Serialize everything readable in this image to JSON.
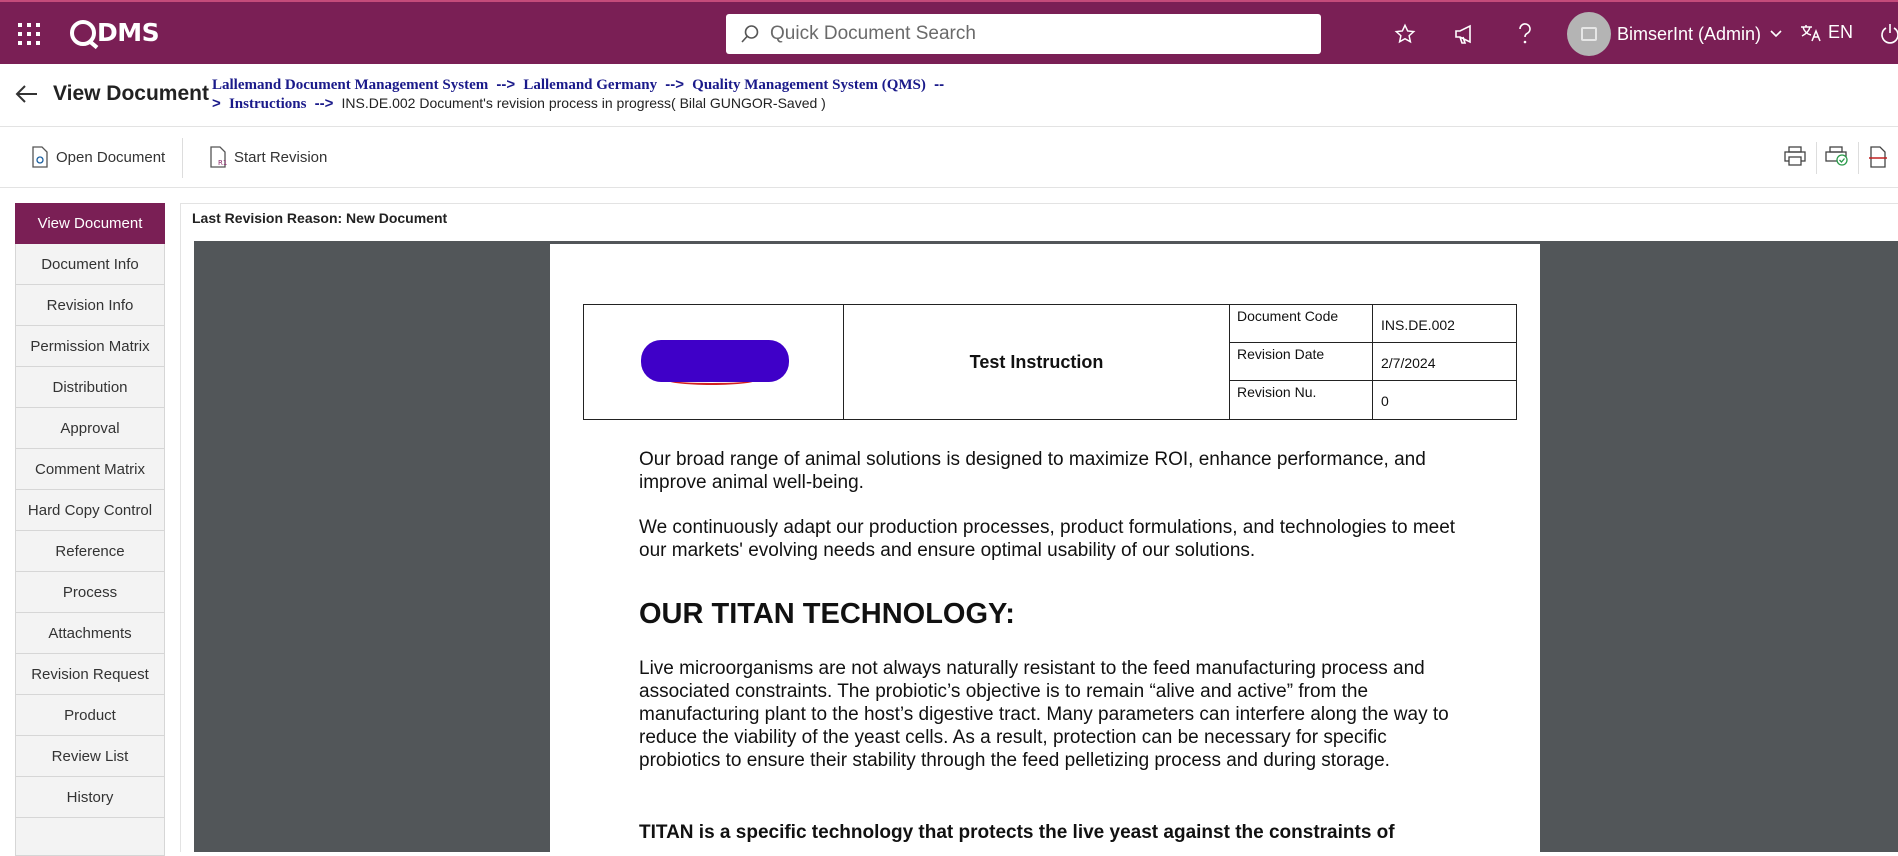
{
  "topbar": {
    "logo_text": "DMS",
    "search_placeholder": "Quick Document Search",
    "user_name": "BimserInt (Admin)",
    "language": "EN",
    "brand_color": "#7a1f55"
  },
  "header": {
    "title": "View Document",
    "breadcrumb": {
      "item1": "Lallemand Document Management System",
      "item2": "Lallemand Germany",
      "item3": "Quality Management System (QMS)",
      "item4": "Instructions",
      "separator": "-->",
      "tail_sep": "--",
      "lead_sep": ">",
      "status": "INS.DE.002 Document's revision process in progress( Bilal GUNGOR-Saved )"
    }
  },
  "toolbar": {
    "open_document": "Open Document",
    "start_revision": "Start Revision"
  },
  "sidebar": {
    "items": [
      "View Document",
      "Document Info",
      "Revision Info",
      "Permission Matrix",
      "Distribution",
      "Approval",
      "Comment Matrix",
      "Hard Copy Control",
      "Reference",
      "Process",
      "Attachments",
      "Revision Request",
      "Product",
      "Review List",
      "History"
    ],
    "active": "View Document"
  },
  "main": {
    "revision_reason": "Last Revision Reason: New Document"
  },
  "document": {
    "title": "Test Instruction",
    "meta": [
      {
        "label": "Document Code",
        "value": "INS.DE.002"
      },
      {
        "label": "Revision Date",
        "value": "2/7/2024"
      },
      {
        "label": "Revision Nu.",
        "value": "0"
      }
    ],
    "para1": "Our broad range of animal solutions is designed to maximize ROI, enhance performance, and improve animal well-being.",
    "para2": "We continuously adapt our production processes, product formulations, and technologies to meet our markets' evolving needs and ensure optimal usability of our solutions.",
    "heading": "OUR TITAN TECHNOLOGY:",
    "para3": "Live microorganisms are not always naturally resistant to the feed manufacturing process and associated constraints. The probiotic’s objective is to remain “alive and active” from the manufacturing plant to the host’s digestive tract. Many parameters can interfere along the way to reduce the viability of the yeast cells. As a result, protection can be necessary for specific probiotics to ensure their stability through the feed pelletizing process and during storage.",
    "para4_bold": "TITAN is a specific technology that protects the live yeast against the constraints of"
  }
}
